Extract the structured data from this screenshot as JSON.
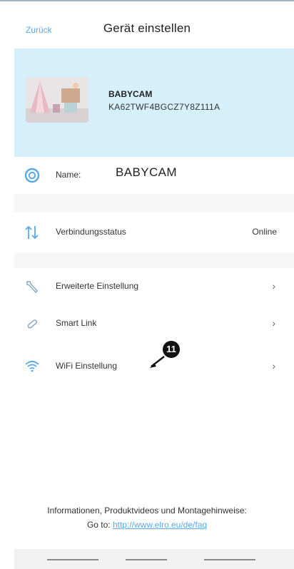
{
  "header": {
    "back_label": "Zurück",
    "title": "Gerät einstellen"
  },
  "device": {
    "name": "BABYCAM",
    "id": "KA62TWF4BGCZ7Y8Z111A"
  },
  "rows": {
    "name": {
      "label": "Name:",
      "value": "BABYCAM",
      "icon": "clock-circle-icon"
    },
    "status": {
      "label": "Verbindungsstatus",
      "value": "Online",
      "icon": "up-down-arrows-icon"
    },
    "advanced": {
      "label": "Erweiterte Einstellung",
      "icon": "wrench-icon"
    },
    "smartlink": {
      "label": "Smart Link",
      "icon": "link-icon"
    },
    "wifi": {
      "label": "WiFi Einstellung",
      "icon": "wifi-icon"
    }
  },
  "annotation": {
    "number": "11"
  },
  "footer": {
    "info": "Informationen, Produktvideos und Montagehinweise:",
    "goto": "Go to:",
    "url": "http://www.elro.eu/de/faq"
  },
  "colors": {
    "accent": "#5aa9e6",
    "card_bg": "#d6f0fb",
    "gap_bg": "#f7f7f7"
  }
}
